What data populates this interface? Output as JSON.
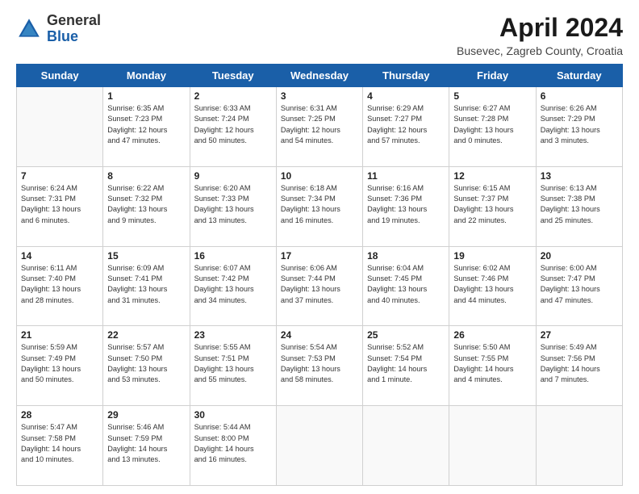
{
  "header": {
    "logo_general": "General",
    "logo_blue": "Blue",
    "title": "April 2024",
    "subtitle": "Busevec, Zagreb County, Croatia"
  },
  "days": [
    "Sunday",
    "Monday",
    "Tuesday",
    "Wednesday",
    "Thursday",
    "Friday",
    "Saturday"
  ],
  "weeks": [
    [
      {
        "num": "",
        "lines": []
      },
      {
        "num": "1",
        "lines": [
          "Sunrise: 6:35 AM",
          "Sunset: 7:23 PM",
          "Daylight: 12 hours",
          "and 47 minutes."
        ]
      },
      {
        "num": "2",
        "lines": [
          "Sunrise: 6:33 AM",
          "Sunset: 7:24 PM",
          "Daylight: 12 hours",
          "and 50 minutes."
        ]
      },
      {
        "num": "3",
        "lines": [
          "Sunrise: 6:31 AM",
          "Sunset: 7:25 PM",
          "Daylight: 12 hours",
          "and 54 minutes."
        ]
      },
      {
        "num": "4",
        "lines": [
          "Sunrise: 6:29 AM",
          "Sunset: 7:27 PM",
          "Daylight: 12 hours",
          "and 57 minutes."
        ]
      },
      {
        "num": "5",
        "lines": [
          "Sunrise: 6:27 AM",
          "Sunset: 7:28 PM",
          "Daylight: 13 hours",
          "and 0 minutes."
        ]
      },
      {
        "num": "6",
        "lines": [
          "Sunrise: 6:26 AM",
          "Sunset: 7:29 PM",
          "Daylight: 13 hours",
          "and 3 minutes."
        ]
      }
    ],
    [
      {
        "num": "7",
        "lines": [
          "Sunrise: 6:24 AM",
          "Sunset: 7:31 PM",
          "Daylight: 13 hours",
          "and 6 minutes."
        ]
      },
      {
        "num": "8",
        "lines": [
          "Sunrise: 6:22 AM",
          "Sunset: 7:32 PM",
          "Daylight: 13 hours",
          "and 9 minutes."
        ]
      },
      {
        "num": "9",
        "lines": [
          "Sunrise: 6:20 AM",
          "Sunset: 7:33 PM",
          "Daylight: 13 hours",
          "and 13 minutes."
        ]
      },
      {
        "num": "10",
        "lines": [
          "Sunrise: 6:18 AM",
          "Sunset: 7:34 PM",
          "Daylight: 13 hours",
          "and 16 minutes."
        ]
      },
      {
        "num": "11",
        "lines": [
          "Sunrise: 6:16 AM",
          "Sunset: 7:36 PM",
          "Daylight: 13 hours",
          "and 19 minutes."
        ]
      },
      {
        "num": "12",
        "lines": [
          "Sunrise: 6:15 AM",
          "Sunset: 7:37 PM",
          "Daylight: 13 hours",
          "and 22 minutes."
        ]
      },
      {
        "num": "13",
        "lines": [
          "Sunrise: 6:13 AM",
          "Sunset: 7:38 PM",
          "Daylight: 13 hours",
          "and 25 minutes."
        ]
      }
    ],
    [
      {
        "num": "14",
        "lines": [
          "Sunrise: 6:11 AM",
          "Sunset: 7:40 PM",
          "Daylight: 13 hours",
          "and 28 minutes."
        ]
      },
      {
        "num": "15",
        "lines": [
          "Sunrise: 6:09 AM",
          "Sunset: 7:41 PM",
          "Daylight: 13 hours",
          "and 31 minutes."
        ]
      },
      {
        "num": "16",
        "lines": [
          "Sunrise: 6:07 AM",
          "Sunset: 7:42 PM",
          "Daylight: 13 hours",
          "and 34 minutes."
        ]
      },
      {
        "num": "17",
        "lines": [
          "Sunrise: 6:06 AM",
          "Sunset: 7:44 PM",
          "Daylight: 13 hours",
          "and 37 minutes."
        ]
      },
      {
        "num": "18",
        "lines": [
          "Sunrise: 6:04 AM",
          "Sunset: 7:45 PM",
          "Daylight: 13 hours",
          "and 40 minutes."
        ]
      },
      {
        "num": "19",
        "lines": [
          "Sunrise: 6:02 AM",
          "Sunset: 7:46 PM",
          "Daylight: 13 hours",
          "and 44 minutes."
        ]
      },
      {
        "num": "20",
        "lines": [
          "Sunrise: 6:00 AM",
          "Sunset: 7:47 PM",
          "Daylight: 13 hours",
          "and 47 minutes."
        ]
      }
    ],
    [
      {
        "num": "21",
        "lines": [
          "Sunrise: 5:59 AM",
          "Sunset: 7:49 PM",
          "Daylight: 13 hours",
          "and 50 minutes."
        ]
      },
      {
        "num": "22",
        "lines": [
          "Sunrise: 5:57 AM",
          "Sunset: 7:50 PM",
          "Daylight: 13 hours",
          "and 53 minutes."
        ]
      },
      {
        "num": "23",
        "lines": [
          "Sunrise: 5:55 AM",
          "Sunset: 7:51 PM",
          "Daylight: 13 hours",
          "and 55 minutes."
        ]
      },
      {
        "num": "24",
        "lines": [
          "Sunrise: 5:54 AM",
          "Sunset: 7:53 PM",
          "Daylight: 13 hours",
          "and 58 minutes."
        ]
      },
      {
        "num": "25",
        "lines": [
          "Sunrise: 5:52 AM",
          "Sunset: 7:54 PM",
          "Daylight: 14 hours",
          "and 1 minute."
        ]
      },
      {
        "num": "26",
        "lines": [
          "Sunrise: 5:50 AM",
          "Sunset: 7:55 PM",
          "Daylight: 14 hours",
          "and 4 minutes."
        ]
      },
      {
        "num": "27",
        "lines": [
          "Sunrise: 5:49 AM",
          "Sunset: 7:56 PM",
          "Daylight: 14 hours",
          "and 7 minutes."
        ]
      }
    ],
    [
      {
        "num": "28",
        "lines": [
          "Sunrise: 5:47 AM",
          "Sunset: 7:58 PM",
          "Daylight: 14 hours",
          "and 10 minutes."
        ]
      },
      {
        "num": "29",
        "lines": [
          "Sunrise: 5:46 AM",
          "Sunset: 7:59 PM",
          "Daylight: 14 hours",
          "and 13 minutes."
        ]
      },
      {
        "num": "30",
        "lines": [
          "Sunrise: 5:44 AM",
          "Sunset: 8:00 PM",
          "Daylight: 14 hours",
          "and 16 minutes."
        ]
      },
      {
        "num": "",
        "lines": []
      },
      {
        "num": "",
        "lines": []
      },
      {
        "num": "",
        "lines": []
      },
      {
        "num": "",
        "lines": []
      }
    ]
  ]
}
